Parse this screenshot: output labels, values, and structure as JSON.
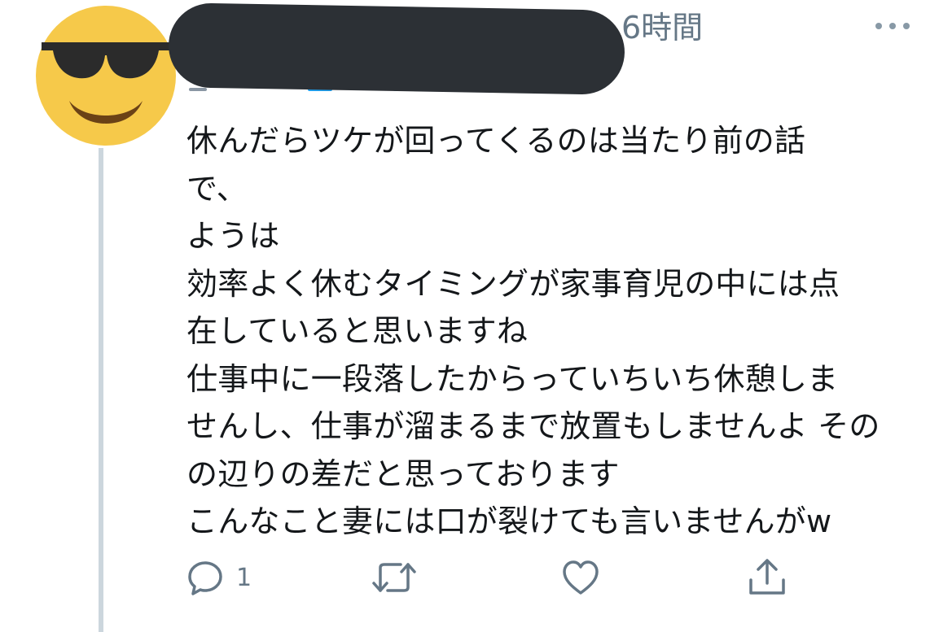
{
  "tweet": {
    "timestamp": "6時間",
    "body_lines": [
      "休んだらツケが回ってくるのは当たり前の話",
      "で、",
      "ようは",
      "効率よく休むタイミングが家事育児の中には点",
      "在していると思いますね",
      "仕事中に一段落したからっていちいち休憩しま",
      "せんし、仕事が溜まるまで放置もしませんよ その",
      "の辺りの差だと思っております",
      "こんなこと妻には口が裂けても言いませんがw"
    ],
    "actions": {
      "reply_count": "1"
    }
  },
  "icons": {
    "avatar": "sunglasses-emoji-icon",
    "more": "more-dots-icon",
    "reply": "reply-bubble-icon",
    "retweet": "retweet-icon",
    "like": "heart-icon",
    "share": "share-icon"
  },
  "colors": {
    "text": "#14171a",
    "secondary_text": "#657786",
    "thread_line": "#ccd6dd",
    "redaction": "#2c3035",
    "avatar_yellow": "#f6c94a",
    "icon_gray": "#657786"
  }
}
